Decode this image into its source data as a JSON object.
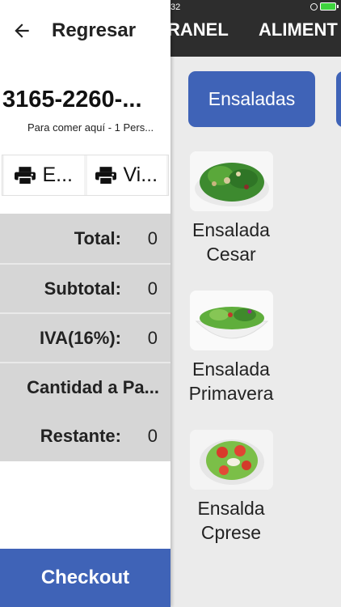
{
  "status_bar": {
    "time": "32"
  },
  "tabs": [
    "RANEL",
    "ALIMENT"
  ],
  "categories": [
    "Ensaladas"
  ],
  "products": [
    {
      "line1": "Ensalada",
      "line2": "Cesar",
      "image": "caesar-salad-photo"
    },
    {
      "line1": "Ensalada",
      "line2": "Primavera",
      "image": "spring-salad-photo"
    },
    {
      "line1": "Ensalda",
      "line2": "Cprese",
      "image": "caprese-salad-photo"
    }
  ],
  "left_panel": {
    "back_label": "Regresar",
    "order_id": "3165-2260-...",
    "order_subtitle": "Para comer aquí - 1 Pers...",
    "buttons": [
      {
        "label": "E...",
        "icon": "printer-icon"
      },
      {
        "label": "Vi...",
        "icon": "printer-icon"
      }
    ],
    "summary": [
      {
        "label": "Total:",
        "value": "0"
      },
      {
        "label": "Subtotal:",
        "value": "0"
      },
      {
        "label": "IVA(16%):",
        "value": "0"
      },
      {
        "label": "Cantidad a Pa...",
        "value": ""
      },
      {
        "label": "Restante:",
        "value": "0"
      }
    ],
    "checkout_label": "Checkout"
  },
  "colors": {
    "accent": "#3f63b7",
    "topbar": "#2d2d2d",
    "summary_bg": "#d6d6d6"
  }
}
